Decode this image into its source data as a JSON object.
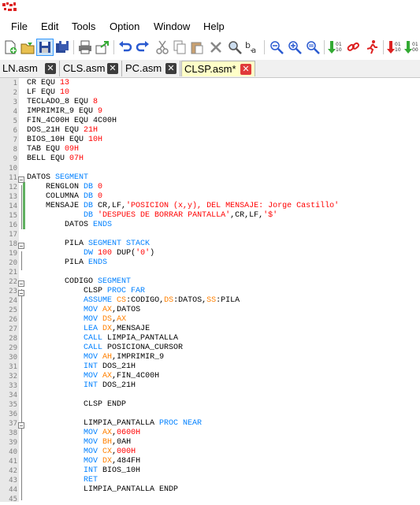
{
  "menu": [
    "File",
    "Edit",
    "Tools",
    "Option",
    "Window",
    "Help"
  ],
  "tabs": [
    {
      "label": "LN.asm",
      "active": false
    },
    {
      "label": "CLS.asm",
      "active": false
    },
    {
      "label": "PC.asm",
      "active": false
    },
    {
      "label": "CLSP.asm*",
      "active": true
    }
  ],
  "toolbar_icons": [
    "new-file-icon",
    "open-file-icon",
    "save-icon",
    "save-all-icon",
    "print-icon",
    "export-icon",
    "undo-icon",
    "redo-icon",
    "cut-icon",
    "copy-icon",
    "paste-icon",
    "delete-icon",
    "find-icon",
    "replace-icon",
    "zoom-out-icon",
    "zoom-in-icon",
    "zoom-reset-icon",
    "assemble-icon",
    "link-icon",
    "run-icon",
    "debug-icon",
    "binary-icon"
  ],
  "lines": [
    {
      "n": "1",
      "t": [
        [
          "CR EQU ",
          ""
        ],
        [
          "13",
          "num"
        ]
      ]
    },
    {
      "n": "2",
      "t": [
        [
          "LF EQU ",
          ""
        ],
        [
          "10",
          "num"
        ]
      ]
    },
    {
      "n": "3",
      "t": [
        [
          "TECLADO_8 EQU ",
          ""
        ],
        [
          "8",
          "num"
        ]
      ]
    },
    {
      "n": "4",
      "t": [
        [
          "IMPRIMIR_9 EQU ",
          ""
        ],
        [
          "9",
          "num"
        ]
      ]
    },
    {
      "n": "5",
      "t": [
        [
          "FIN_4C00H EQU 4C00H",
          ""
        ]
      ]
    },
    {
      "n": "6",
      "t": [
        [
          "DOS_21H EQU ",
          ""
        ],
        [
          "21H",
          "num"
        ]
      ]
    },
    {
      "n": "7",
      "t": [
        [
          "BIOS_10H EQU ",
          ""
        ],
        [
          "10H",
          "num"
        ]
      ]
    },
    {
      "n": "8",
      "t": [
        [
          "TAB EQU ",
          ""
        ],
        [
          "09H",
          "num"
        ]
      ]
    },
    {
      "n": "9",
      "t": [
        [
          "BELL EQU ",
          ""
        ],
        [
          "07H",
          "num"
        ]
      ]
    },
    {
      "n": "10",
      "t": []
    },
    {
      "n": "11",
      "t": [
        [
          "DATOS ",
          ""
        ],
        [
          "SEGMENT",
          "kw"
        ]
      ]
    },
    {
      "n": "12",
      "t": [
        [
          "    RENGLON ",
          ""
        ],
        [
          "DB",
          "kw"
        ],
        [
          " ",
          ""
        ],
        [
          "0",
          "num"
        ]
      ]
    },
    {
      "n": "13",
      "t": [
        [
          "    COLUMNA ",
          ""
        ],
        [
          "DB",
          "kw"
        ],
        [
          " ",
          ""
        ],
        [
          "0",
          "num"
        ]
      ]
    },
    {
      "n": "14",
      "t": [
        [
          "    MENSAJE ",
          ""
        ],
        [
          "DB",
          "kw"
        ],
        [
          " CR,LF,",
          ""
        ],
        [
          "'POSICION (x,y), DEL MENSAJE: Jorge Castillo'",
          "str"
        ]
      ]
    },
    {
      "n": "15",
      "t": [
        [
          "            ",
          ""
        ],
        [
          "DB",
          "kw"
        ],
        [
          " ",
          ""
        ],
        [
          "'DESPUES DE BORRAR PANTALLA'",
          "str"
        ],
        [
          ",CR,LF,",
          ""
        ],
        [
          "'$'",
          "str"
        ]
      ]
    },
    {
      "n": "16",
      "t": [
        [
          "        DATOS ",
          ""
        ],
        [
          "ENDS",
          "kw"
        ]
      ]
    },
    {
      "n": "17",
      "t": []
    },
    {
      "n": "18",
      "t": [
        [
          "        PILA ",
          ""
        ],
        [
          "SEGMENT STACK",
          "kw"
        ]
      ]
    },
    {
      "n": "19",
      "t": [
        [
          "            ",
          ""
        ],
        [
          "DW",
          "kw"
        ],
        [
          " ",
          ""
        ],
        [
          "100",
          "num"
        ],
        [
          " DUP(",
          ""
        ],
        [
          "'0'",
          "str"
        ],
        [
          ")",
          ""
        ]
      ]
    },
    {
      "n": "20",
      "t": [
        [
          "        PILA ",
          ""
        ],
        [
          "ENDS",
          "kw"
        ]
      ]
    },
    {
      "n": "21",
      "t": []
    },
    {
      "n": "22",
      "t": [
        [
          "        CODIGO ",
          ""
        ],
        [
          "SEGMENT",
          "kw"
        ]
      ]
    },
    {
      "n": "23",
      "t": [
        [
          "            CLSP ",
          ""
        ],
        [
          "PROC FAR",
          "kw"
        ]
      ]
    },
    {
      "n": "24",
      "t": [
        [
          "            ",
          ""
        ],
        [
          "ASSUME",
          "kw"
        ],
        [
          " ",
          ""
        ],
        [
          "CS",
          "reg"
        ],
        [
          ":CODIGO,",
          ""
        ],
        [
          "DS",
          "reg"
        ],
        [
          ":DATOS,",
          ""
        ],
        [
          "SS",
          "reg"
        ],
        [
          ":PILA",
          ""
        ]
      ]
    },
    {
      "n": "25",
      "t": [
        [
          "            ",
          ""
        ],
        [
          "MOV",
          "kw"
        ],
        [
          " ",
          ""
        ],
        [
          "AX",
          "reg"
        ],
        [
          ",DATOS",
          ""
        ]
      ]
    },
    {
      "n": "26",
      "t": [
        [
          "            ",
          ""
        ],
        [
          "MOV",
          "kw"
        ],
        [
          " ",
          ""
        ],
        [
          "DS",
          "reg"
        ],
        [
          ",",
          ""
        ],
        [
          "AX",
          "reg"
        ]
      ]
    },
    {
      "n": "27",
      "t": [
        [
          "            ",
          ""
        ],
        [
          "LEA",
          "kw"
        ],
        [
          " ",
          ""
        ],
        [
          "DX",
          "reg"
        ],
        [
          ",MENSAJE",
          ""
        ]
      ]
    },
    {
      "n": "28",
      "t": [
        [
          "            ",
          ""
        ],
        [
          "CALL",
          "kw"
        ],
        [
          " LIMPIA_PANTALLA",
          ""
        ]
      ]
    },
    {
      "n": "29",
      "t": [
        [
          "            ",
          ""
        ],
        [
          "CALL",
          "kw"
        ],
        [
          " POSICIONA_CURSOR",
          ""
        ]
      ]
    },
    {
      "n": "30",
      "t": [
        [
          "            ",
          ""
        ],
        [
          "MOV",
          "kw"
        ],
        [
          " ",
          ""
        ],
        [
          "AH",
          "reg"
        ],
        [
          ",IMPRIMIR_9",
          ""
        ]
      ]
    },
    {
      "n": "31",
      "t": [
        [
          "            ",
          ""
        ],
        [
          "INT",
          "kw"
        ],
        [
          " DOS_21H",
          ""
        ]
      ]
    },
    {
      "n": "32",
      "t": [
        [
          "            ",
          ""
        ],
        [
          "MOV",
          "kw"
        ],
        [
          " ",
          ""
        ],
        [
          "AX",
          "reg"
        ],
        [
          ",FIN_4C00H",
          ""
        ]
      ]
    },
    {
      "n": "33",
      "t": [
        [
          "            ",
          ""
        ],
        [
          "INT",
          "kw"
        ],
        [
          " DOS_21H",
          ""
        ]
      ]
    },
    {
      "n": "34",
      "t": []
    },
    {
      "n": "35",
      "t": [
        [
          "            CLSP ENDP",
          ""
        ]
      ]
    },
    {
      "n": "36",
      "t": []
    },
    {
      "n": "37",
      "t": [
        [
          "            LIMPIA_PANTALLA ",
          ""
        ],
        [
          "PROC NEAR",
          "kw"
        ]
      ]
    },
    {
      "n": "38",
      "t": [
        [
          "            ",
          ""
        ],
        [
          "MOV",
          "kw"
        ],
        [
          " ",
          ""
        ],
        [
          "AX",
          "reg"
        ],
        [
          ",",
          ""
        ],
        [
          "0600H",
          "num"
        ]
      ]
    },
    {
      "n": "39",
      "t": [
        [
          "            ",
          ""
        ],
        [
          "MOV",
          "kw"
        ],
        [
          " ",
          ""
        ],
        [
          "BH",
          "reg"
        ],
        [
          ",0AH",
          ""
        ]
      ]
    },
    {
      "n": "40",
      "t": [
        [
          "            ",
          ""
        ],
        [
          "MOV",
          "kw"
        ],
        [
          " ",
          ""
        ],
        [
          "CX",
          "reg"
        ],
        [
          ",",
          ""
        ],
        [
          "000H",
          "num"
        ]
      ]
    },
    {
      "n": "41",
      "t": [
        [
          "            ",
          ""
        ],
        [
          "MOV",
          "kw"
        ],
        [
          " ",
          ""
        ],
        [
          "DX",
          "reg"
        ],
        [
          ",484FH",
          ""
        ]
      ]
    },
    {
      "n": "42",
      "t": [
        [
          "            ",
          ""
        ],
        [
          "INT",
          "kw"
        ],
        [
          " BIOS_10H",
          ""
        ]
      ]
    },
    {
      "n": "43",
      "t": [
        [
          "            ",
          ""
        ],
        [
          "RET",
          "kw"
        ]
      ]
    },
    {
      "n": "44",
      "t": [
        [
          "            LIMPIA_PANTALLA ENDP",
          ""
        ]
      ]
    },
    {
      "n": "45",
      "t": []
    }
  ]
}
